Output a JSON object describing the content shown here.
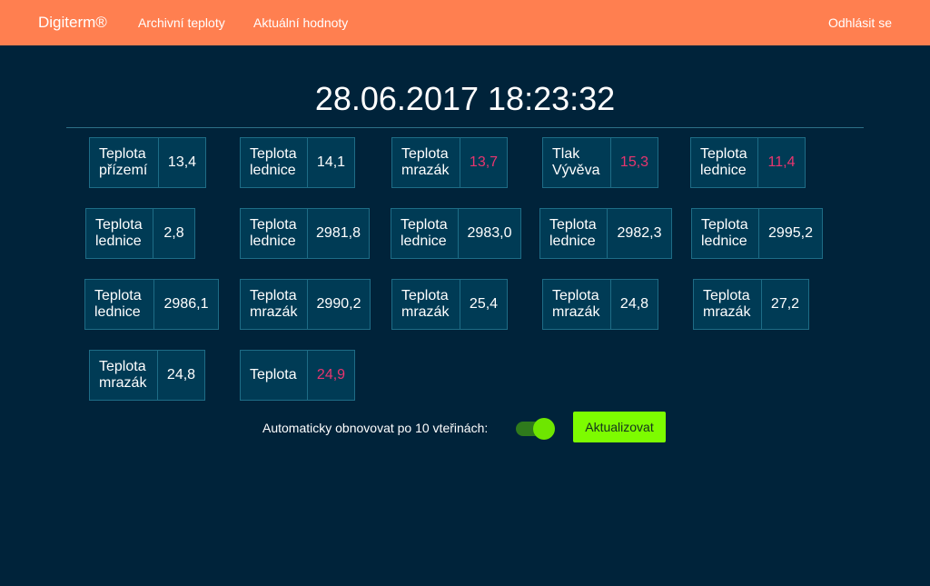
{
  "navbar": {
    "brand": "Digiterm®",
    "links": [
      "Archivní teploty",
      "Aktuální hodnoty"
    ],
    "logout": "Odhlásit se",
    "color": "#ff7f50"
  },
  "datetime": "28.06.2017 18:23:32",
  "sensors": [
    {
      "label": "Teplota přízemí",
      "value": "13,4",
      "alert": false
    },
    {
      "label": "Teplota lednice",
      "value": "14,1",
      "alert": false
    },
    {
      "label": "Teplota mrazák",
      "value": "13,7",
      "alert": true
    },
    {
      "label": "Tlak Vývěva",
      "value": "15,3",
      "alert": true
    },
    {
      "label": "Teplota lednice",
      "value": "11,4",
      "alert": true
    },
    {
      "label": "Teplota lednice",
      "value": "2,8",
      "alert": false
    },
    {
      "label": "Teplota lednice",
      "value": "2981,8",
      "alert": false
    },
    {
      "label": "Teplota lednice",
      "value": "2983,0",
      "alert": false
    },
    {
      "label": "Teplota lednice",
      "value": "2982,3",
      "alert": false
    },
    {
      "label": "Teplota lednice",
      "value": "2995,2",
      "alert": false
    },
    {
      "label": "Teplota lednice",
      "value": "2986,1",
      "alert": false
    },
    {
      "label": "Teplota mrazák",
      "value": "2990,2",
      "alert": false
    },
    {
      "label": "Teplota mrazák",
      "value": "25,4",
      "alert": false
    },
    {
      "label": "Teplota mrazák",
      "value": "24,8",
      "alert": false
    },
    {
      "label": "Teplota mrazák",
      "value": "27,2",
      "alert": false
    },
    {
      "label": "Teplota mrazák",
      "value": "24,8",
      "alert": false
    },
    {
      "label": "Teplota",
      "value": "24,9",
      "alert": true
    }
  ],
  "auto_refresh": {
    "label": "Automaticky obnovovat po 10 vteřinách:",
    "enabled": true
  },
  "update_button": "Aktualizovat",
  "colors": {
    "background": "#00233a",
    "card": "#003b55",
    "alert": "#e8356f",
    "accent_green": "#7dfc00"
  }
}
